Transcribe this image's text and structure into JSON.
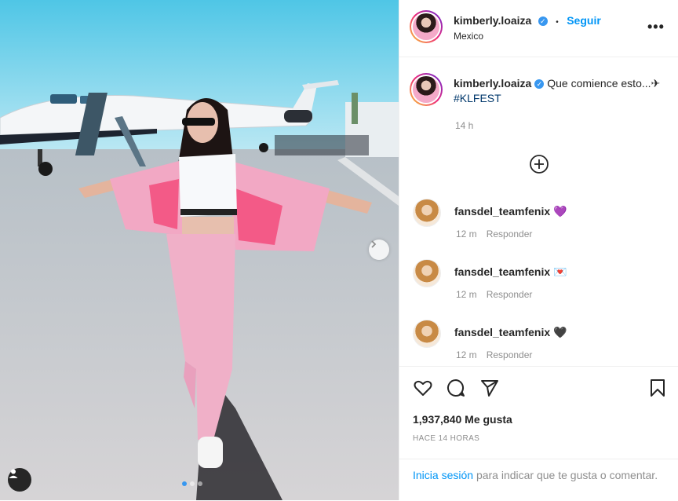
{
  "post": {
    "author": "kimberly.loaiza",
    "follow_label": "Seguir",
    "separator": "•",
    "location": "Mexico",
    "more_label": "•••",
    "caption_text": "Que comience esto...✈",
    "caption_hashtag": "#KLFEST",
    "caption_time": "14 h",
    "likes": "1,937,840 Me gusta",
    "posted_ago": "HACE 14 HORAS",
    "carousel": {
      "slides": 3,
      "active_index": 0
    }
  },
  "comments": [
    {
      "user": "fansdel_teamfenix",
      "emoji": "💜",
      "time": "12 m",
      "reply_label": "Responder"
    },
    {
      "user": "fansdel_teamfenix",
      "emoji": "💌",
      "time": "12 m",
      "reply_label": "Responder"
    },
    {
      "user": "fansdel_teamfenix",
      "emoji": "🖤",
      "time": "12 m",
      "reply_label": "Responder"
    }
  ],
  "login": {
    "link_label": "Inicia sesión",
    "rest_text": "para indicar que te gusta o comentar."
  },
  "icons": {
    "verified": "verified-badge-icon",
    "load_more": "plus-circle-icon",
    "like": "heart-icon",
    "comment": "comment-icon",
    "share": "paper-plane-icon",
    "save": "bookmark-icon",
    "next": "chevron-right-icon",
    "tags": "user-tag-icon"
  },
  "colors": {
    "accent": "#0095f6",
    "verified": "#3897f0",
    "hashtag": "#00376b",
    "muted": "#8e8e8e"
  }
}
